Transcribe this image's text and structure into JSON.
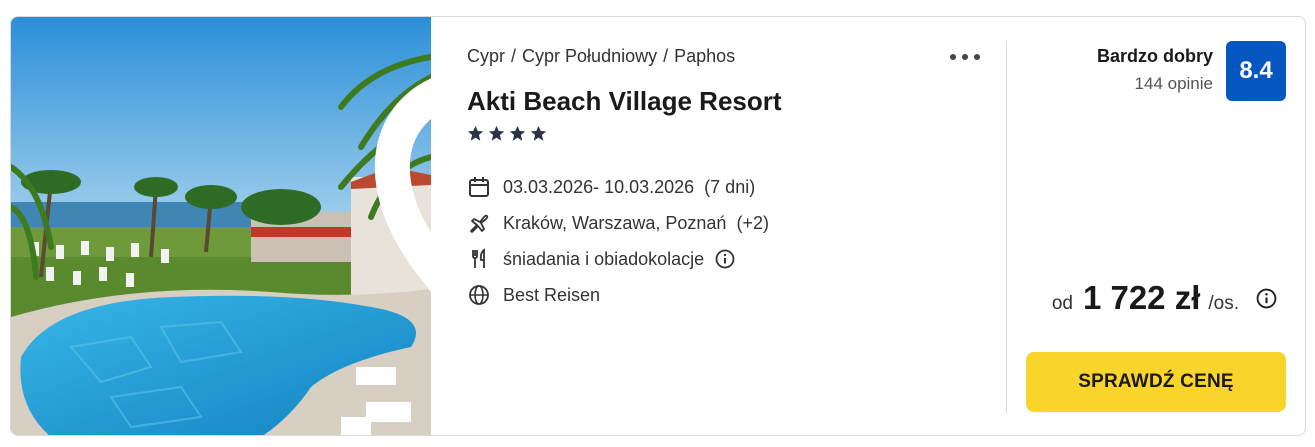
{
  "breadcrumb": [
    "Cypr",
    "Cypr Południowy",
    "Paphos"
  ],
  "breadcrumb_separator": "/",
  "hotel": {
    "name": "Akti Beach Village Resort",
    "stars": 4
  },
  "details": {
    "dates": "03.03.2026- 10.03.2026",
    "duration": "(7 dni)",
    "departure": "Kraków, Warszawa, Poznań",
    "departure_more": "(+2)",
    "board": "śniadania i obiadokolacje",
    "operator": "Best Reisen"
  },
  "rating": {
    "label": "Bardzo dobry",
    "reviews": "144 opinie",
    "score": "8.4",
    "color": "#0757c3"
  },
  "price": {
    "prefix": "od",
    "amount": "1 722 zł",
    "suffix": "/os."
  },
  "cta_label": "SPRAWDŹ CENĘ",
  "icons": {
    "favorite": "heart-outline-icon",
    "more": "more-horizontal-icon",
    "dates": "calendar-icon",
    "departure": "airplane-icon",
    "board": "cutlery-icon",
    "operator": "globe-icon",
    "info": "info-circle-icon"
  },
  "colors": {
    "cta": "#f9d42a",
    "stars": "#2c3345"
  }
}
